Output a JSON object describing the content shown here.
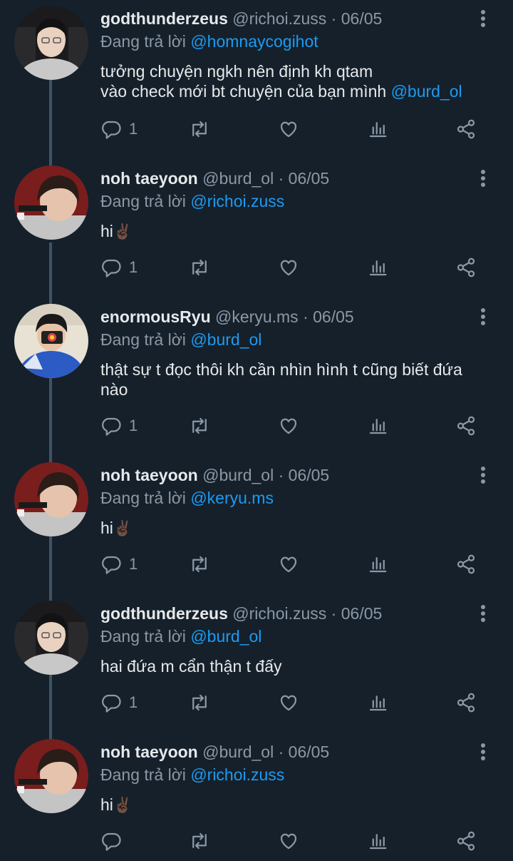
{
  "tweets": [
    {
      "name": "godthunderzeus",
      "handle": "@richoi.zuss",
      "date": "06/05",
      "replying_prefix": "Đang trả lời",
      "replying_to": "@homnaycogihot",
      "line1": "tưởng chuyện ngkh nên định kh qtam",
      "line2": "vào check mới bt chuyện của bạn mình",
      "line2_mention": "@burd_ol",
      "reply_count": "1"
    },
    {
      "name": "noh taeyoon",
      "handle": "@burd_ol",
      "date": "06/05",
      "replying_prefix": "Đang trả lời",
      "replying_to": "@richoi.zuss",
      "text": "hi",
      "emoji": "✌🏿",
      "reply_count": "1"
    },
    {
      "name": "enormousRyu",
      "handle": "@keryu.ms",
      "date": "06/05",
      "replying_prefix": "Đang trả lời",
      "replying_to": "@burd_ol",
      "line1": "thật sự t đọc thôi kh cần nhìn hình t cũng biết đứa",
      "line2": "nào",
      "reply_count": "1"
    },
    {
      "name": "noh taeyoon",
      "handle": "@burd_ol",
      "date": "06/05",
      "replying_prefix": "Đang trả lời",
      "replying_to": "@keryu.ms",
      "text": "hi",
      "emoji": "✌🏿",
      "reply_count": "1"
    },
    {
      "name": "godthunderzeus",
      "handle": "@richoi.zuss",
      "date": "06/05",
      "replying_prefix": "Đang trả lời",
      "replying_to": "@burd_ol",
      "text": "hai đứa m cẩn thận t đấy",
      "reply_count": "1"
    },
    {
      "name": "noh taeyoon",
      "handle": "@burd_ol",
      "date": "06/05",
      "replying_prefix": "Đang trả lời",
      "replying_to": "@richoi.zuss",
      "text": "hi",
      "emoji": "✌🏿",
      "reply_count": ""
    }
  ],
  "separator": "·",
  "icons": [
    "reply-icon",
    "retweet-icon",
    "like-icon",
    "views-icon",
    "share-icon",
    "more-icon"
  ],
  "colors": {
    "background": "#15202b",
    "mention": "#1d9bf0",
    "muted": "#8b98a5",
    "text": "#e7e9ea"
  }
}
